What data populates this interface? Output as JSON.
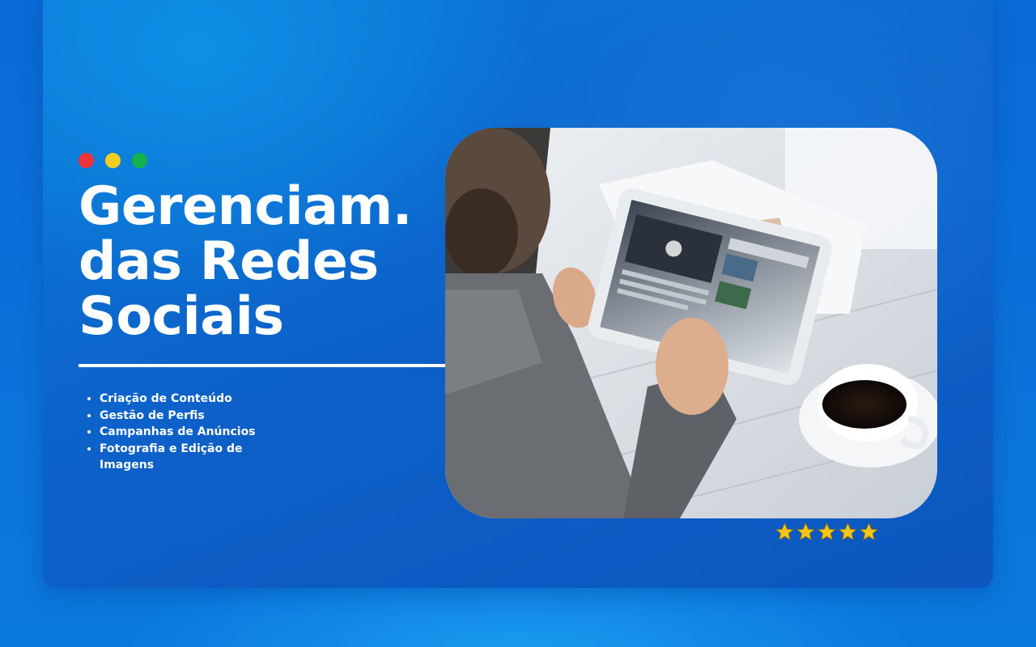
{
  "window_dots": [
    "red",
    "yellow",
    "green"
  ],
  "colors": {
    "red": "#f0333a",
    "yellow": "#f4cc22",
    "green": "#12b34a",
    "background": "#0b78dc",
    "text": "#ffffff",
    "star": "#f5c518"
  },
  "headline": {
    "line1": "Gerenciam.",
    "line2": "das Redes",
    "line3": "Sociais"
  },
  "features": [
    "Criação de Conteúdo",
    "Gestão de Perfis",
    "Campanhas de Anúncios",
    "Fotografia e Edição de Imagens"
  ],
  "photo": {
    "subject": "man-using-tablet-with-coffee"
  },
  "rating": {
    "stars": 5,
    "max": 5,
    "icon": "star-icon"
  }
}
